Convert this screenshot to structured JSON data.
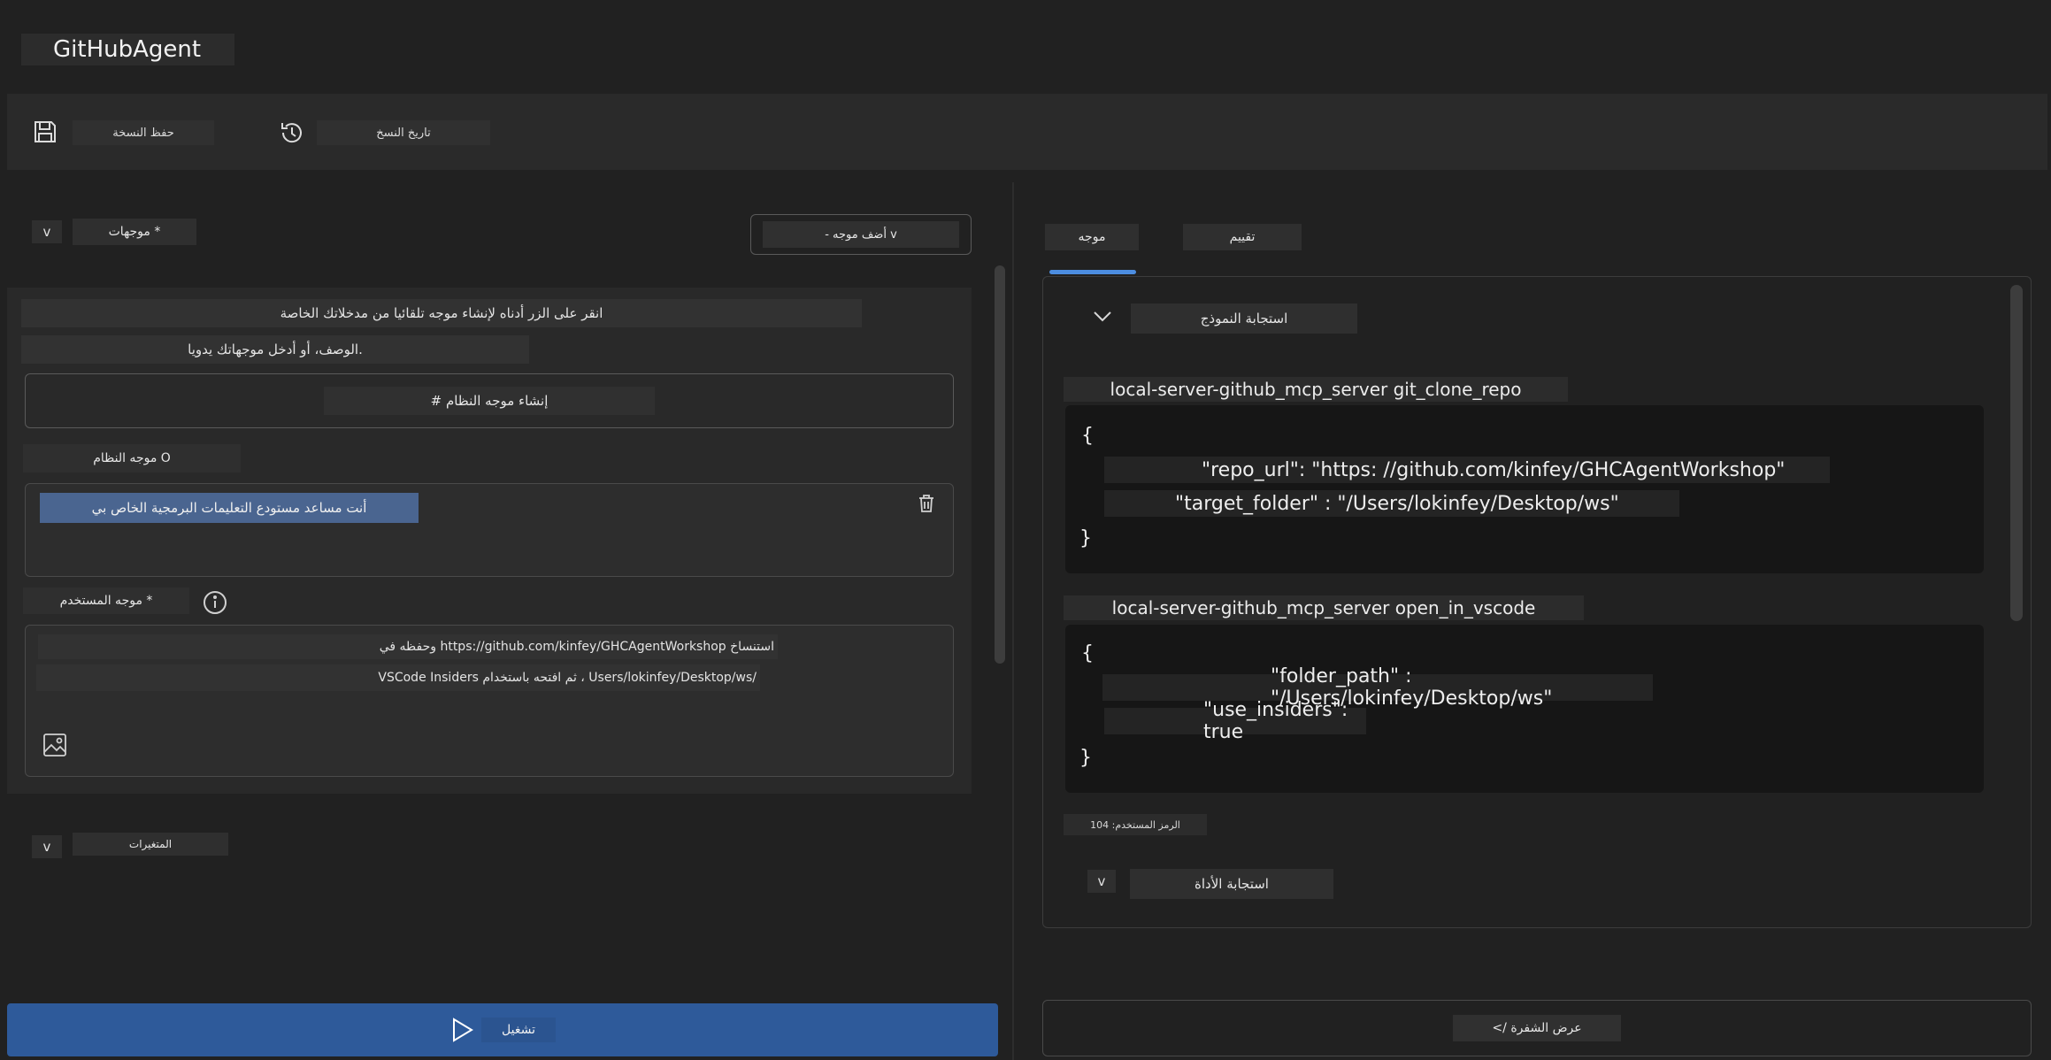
{
  "app": {
    "title": "GitHubAgent"
  },
  "toolbar": {
    "save_label": "حفظ النسخة",
    "history_label": "تاريخ النسخ"
  },
  "prompts": {
    "collapse_glyph": "v",
    "section_label": "موجهات *",
    "add_prompt_label": "- أضف موجه v",
    "hint_line1": "انقر على الزر أدناه لإنشاء موجه تلقائيا من مدخلاتك الخاصة",
    "hint_line2": "الوصف، أو أدخل موجهاتك يدويا.",
    "generate_label": "# إنشاء موجه النظام",
    "system_label": "موجه النظام O",
    "system_value": "أنت مساعد مستودع التعليمات البرمجية الخاص بي",
    "user_label": "موجه المستخدم *",
    "user_line1": "استنساخ https://github.com/kinfey/GHCAgentWorkshop وحفظه في",
    "user_line2": "/Users/lokinfey/Desktop/ws ، ثم افتحه باستخدام VSCode Insiders"
  },
  "variables": {
    "collapse_glyph": "v",
    "label": "المتغيرات"
  },
  "run": {
    "label": "تشغيل"
  },
  "right": {
    "tabs": [
      {
        "label": "موجه"
      },
      {
        "label": "تقييم"
      }
    ],
    "model_response_label": "استجابة النموذج",
    "calls": [
      {
        "title": "local-server-github_mcp_server git_clone_repo",
        "open_brace": "{",
        "lines": [
          "\"repo_url\": \"https: //github.com/kinfey/GHCAgentWorkshop\"",
          "\"target_folder\" : \"/Users/lokinfey/Desktop/ws\""
        ],
        "close_brace": "}"
      },
      {
        "title": "local-server-github_mcp_server open_in_vscode",
        "open_brace": "{",
        "lines": [
          "\"folder_path\" : \"/Users/lokinfey/Desktop/ws\"",
          "\"use_insiders\": true"
        ],
        "close_brace": "}"
      }
    ],
    "tokens_label": "الرمز المستخدم: 104",
    "tool_response_glyph": "v",
    "tool_response_label": "استجابة الأداة",
    "view_code_label": "</ عرض الشفرة"
  }
}
